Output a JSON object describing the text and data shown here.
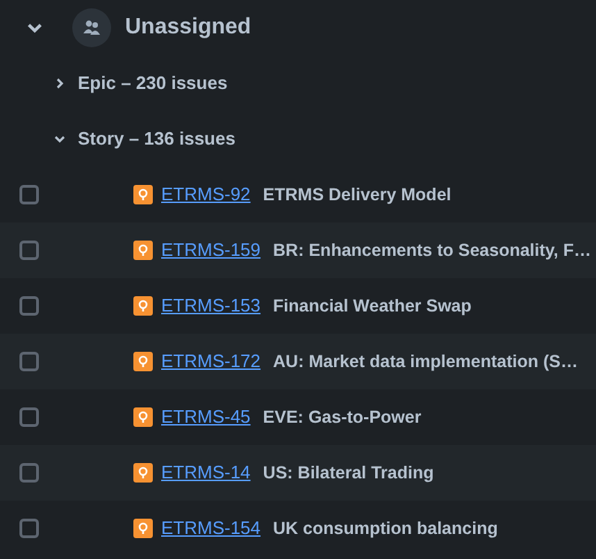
{
  "group": {
    "title": "Unassigned",
    "expanded": true,
    "subgroups": [
      {
        "label": "Epic – 230 issues",
        "expanded": false
      },
      {
        "label": "Story – 136 issues",
        "expanded": true,
        "issues": [
          {
            "key": "ETRMS-92",
            "summary": "ETRMS Delivery Model",
            "checked": false
          },
          {
            "key": "ETRMS-159",
            "summary": "BR: Enhancements to Seasonality, F…",
            "checked": false
          },
          {
            "key": "ETRMS-153",
            "summary": "Financial Weather Swap",
            "checked": false
          },
          {
            "key": "ETRMS-172",
            "summary": "AU: Market data implementation (S…",
            "checked": false
          },
          {
            "key": "ETRMS-45",
            "summary": "EVE: Gas-to-Power",
            "checked": false
          },
          {
            "key": "ETRMS-14",
            "summary": "US: Bilateral Trading",
            "checked": false
          },
          {
            "key": "ETRMS-154",
            "summary": "UK consumption balancing",
            "checked": false
          }
        ]
      }
    ]
  }
}
